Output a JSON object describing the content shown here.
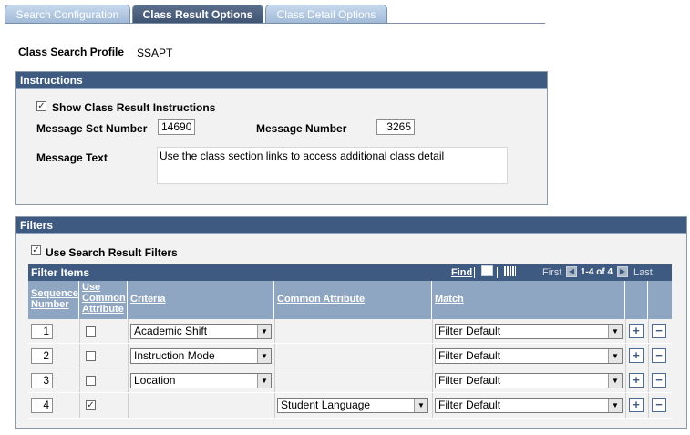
{
  "tabs": [
    {
      "label": "Search Configuration"
    },
    {
      "label": "Class Result Options"
    },
    {
      "label": "Class Detail Options"
    }
  ],
  "profile": {
    "label": "Class Search Profile",
    "value": "SSAPT"
  },
  "instructions": {
    "title": "Instructions",
    "show_label": "Show Class Result Instructions",
    "show_checked_glyph": "✓",
    "message_set_label": "Message Set Number",
    "message_set_value": "14690",
    "message_number_label": "Message Number",
    "message_number_value": "3265",
    "message_text_label": "Message Text",
    "message_text_value": "Use the class section links to access additional class detail"
  },
  "filters": {
    "title": "Filters",
    "use_label": "Use Search Result Filters",
    "use_checked_glyph": "✓",
    "grid": {
      "title": "Filter Items",
      "find": "Find",
      "first": "First",
      "range": "1-4 of 4",
      "last": "Last",
      "columns": {
        "seq_line1": "Sequence",
        "seq_line2": "Number",
        "use_line1": "Use",
        "use_line2": "Common",
        "use_line3": "Attribute",
        "criteria": "Criteria",
        "common": "Common Attribute",
        "match": "Match"
      },
      "rows": [
        {
          "seq": "1",
          "use": "",
          "criteria": "Academic Shift",
          "common": "",
          "match": "Filter Default"
        },
        {
          "seq": "2",
          "use": "",
          "criteria": "Instruction Mode",
          "common": "",
          "match": "Filter Default"
        },
        {
          "seq": "3",
          "use": "",
          "criteria": "Location",
          "common": "",
          "match": "Filter Default"
        },
        {
          "seq": "4",
          "use": "✓",
          "criteria": "",
          "common": "Student Language",
          "match": "Filter Default"
        }
      ]
    }
  },
  "glyphs": {
    "add": "+",
    "remove": "−",
    "dropdown": "▼",
    "prev": "◀",
    "next": "▶"
  }
}
